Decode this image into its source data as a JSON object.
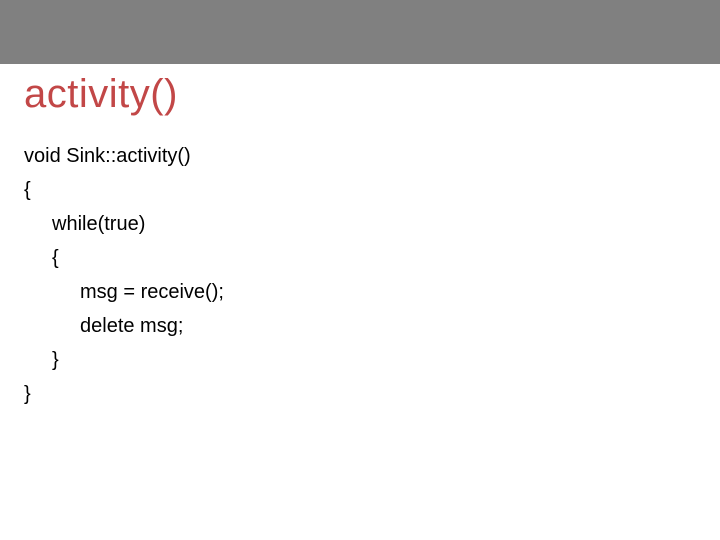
{
  "title": "activity()",
  "code": {
    "l0": "void Sink::activity()",
    "l1": "{",
    "l2": "while(true)",
    "l3": "{",
    "l4": "msg = receive();",
    "l5": "delete msg;",
    "l6": "}",
    "l7": "}"
  }
}
